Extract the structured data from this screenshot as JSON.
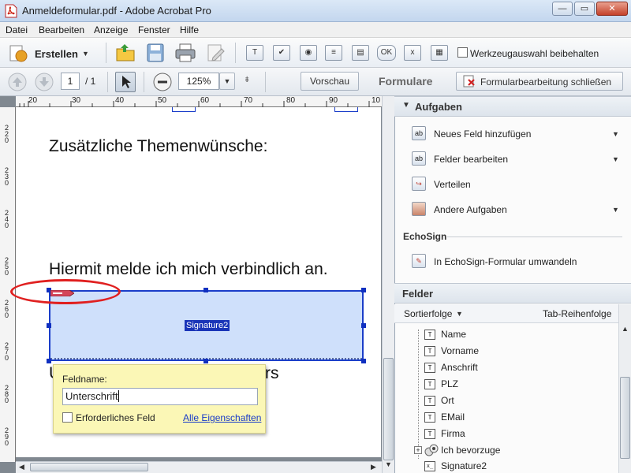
{
  "window": {
    "title": "Anmeldeformular.pdf - Adobe Acrobat Pro",
    "controls": {
      "minimize": "—",
      "restore": "▭",
      "close": "✕"
    }
  },
  "menu": [
    "Datei",
    "Bearbeiten",
    "Anzeige",
    "Fenster",
    "Hilfe"
  ],
  "toolbar1": {
    "create_label": "Erstellen",
    "keep_tool_label": "Werkzeugauswahl beibehalten",
    "form_tool_glyphs": [
      "T",
      "✔",
      "◉",
      "≡",
      "▤",
      "OK",
      "x",
      "▦"
    ]
  },
  "toolbar2": {
    "page_current": "1",
    "page_total": "/ 1",
    "zoom": "125%",
    "preview_label": "Vorschau",
    "mode_label": "Formulare",
    "close_edit_label": "Formularbearbeitung schließen"
  },
  "ruler": {
    "top_marks": [
      "20",
      "30",
      "40",
      "50",
      "60",
      "70",
      "80",
      "90",
      "10"
    ],
    "left_marks": [
      "2\n2\n0",
      "2\n3\n0",
      "2\n4\n0",
      "2\n5\n0",
      "2\n6\n0",
      "2\n7\n0",
      "2\n8\n0",
      "2\n9\n0"
    ]
  },
  "document": {
    "heading1": "Zusätzliche Themenwünsche:",
    "heading2": "Hiermit melde ich mich verbindlich an.",
    "partial_left": "U",
    "partial_right": "rs",
    "signature_field_name": "Signature2"
  },
  "popup": {
    "fieldname_label": "Feldname:",
    "fieldname_value": "Unterschrift",
    "required_label": "Erforderliches Feld",
    "all_props_link": "Alle Eigenschaften"
  },
  "tasks": {
    "header": "Aufgaben",
    "items": [
      {
        "label": "Neues Feld hinzufügen",
        "has_dropdown": true
      },
      {
        "label": "Felder bearbeiten",
        "has_dropdown": true
      },
      {
        "label": "Verteilen",
        "has_dropdown": false
      },
      {
        "label": "Andere Aufgaben",
        "has_dropdown": true
      }
    ],
    "echosign_header": "EchoSign",
    "echosign_item": "In EchoSign-Formular umwandeln"
  },
  "fields": {
    "header": "Felder",
    "sort_label": "Sortierfolge",
    "tab_order_label": "Tab-Reihenfolge",
    "items": [
      {
        "label": "Name",
        "icon": "text-field-icon"
      },
      {
        "label": "Vorname",
        "icon": "text-field-icon"
      },
      {
        "label": "Anschrift",
        "icon": "text-field-icon"
      },
      {
        "label": "PLZ",
        "icon": "text-field-icon"
      },
      {
        "label": "Ort",
        "icon": "text-field-icon"
      },
      {
        "label": "EMail",
        "icon": "text-field-icon"
      },
      {
        "label": "Firma",
        "icon": "text-field-icon"
      },
      {
        "label": "Ich bevorzuge",
        "icon": "radio-group-icon"
      },
      {
        "label": "Signature2",
        "icon": "signature-field-icon"
      }
    ]
  },
  "colors": {
    "accent_blue": "#1b3ec9",
    "signature_fill": "#cfe0fb",
    "highlight_red": "#e02020",
    "popup_yellow": "#fbf7b6"
  }
}
